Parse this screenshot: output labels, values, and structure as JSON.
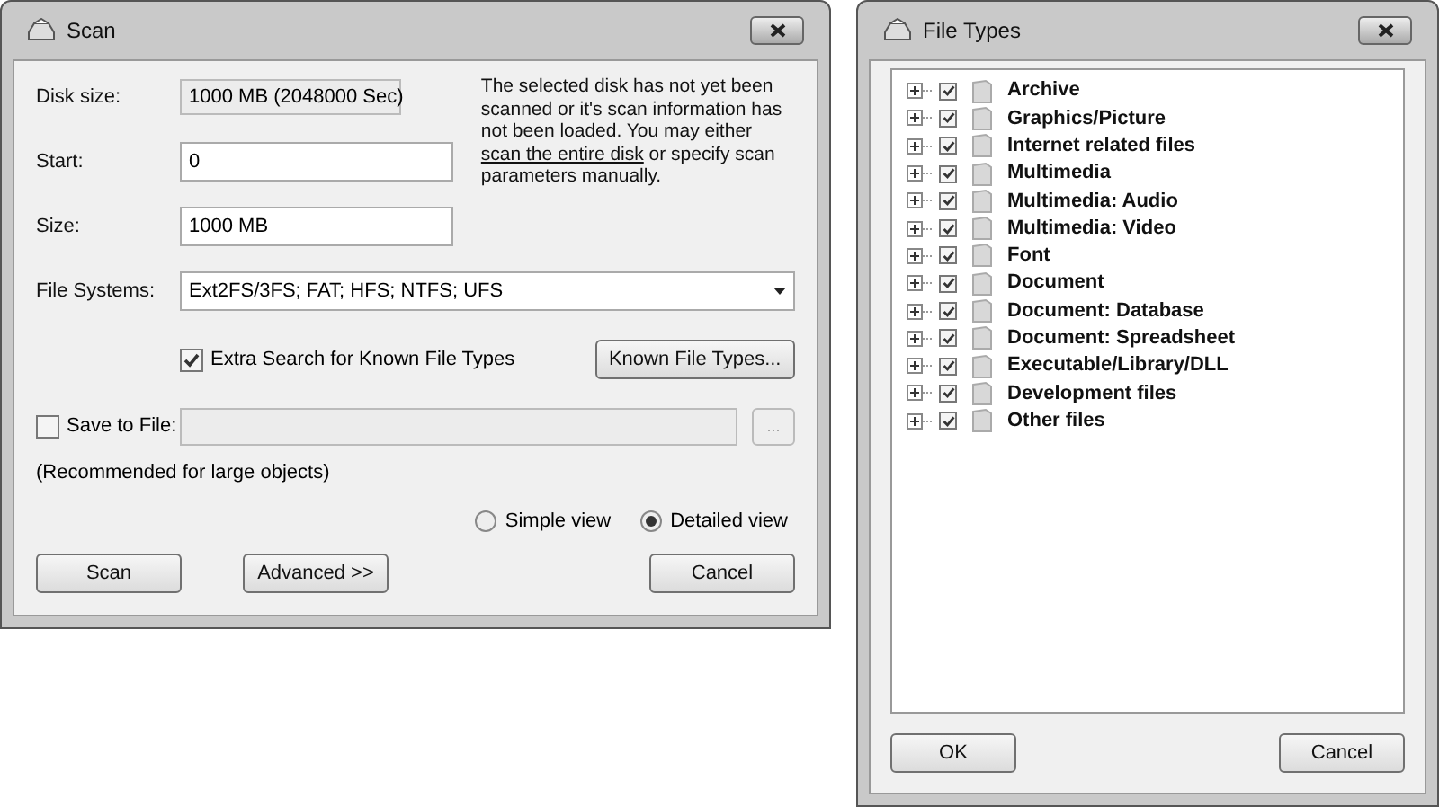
{
  "scan_window": {
    "title": "Scan",
    "disk_size": {
      "label": "Disk size:",
      "value": "1000 MB (2048000 Sec)"
    },
    "start": {
      "label": "Start:",
      "value": "0"
    },
    "size": {
      "label": "Size:",
      "value": "1000 MB"
    },
    "info": {
      "before": "The selected disk has not yet been scanned or it's scan information has not been loaded. You may either ",
      "link": "scan the entire disk",
      "after": " or specify scan parameters manually."
    },
    "file_systems": {
      "label": "File Systems:",
      "value": "Ext2FS/3FS; FAT; HFS; NTFS; UFS"
    },
    "extra_search": {
      "label": "Extra Search for Known File Types",
      "checked": true
    },
    "known_types_button": "Known File Types...",
    "save_to_file": {
      "label": "Save to File:",
      "checked": false,
      "browse": "..."
    },
    "note": "(Recommended for large objects)",
    "views": [
      {
        "label": "Simple view",
        "selected": false
      },
      {
        "label": "Detailed view",
        "selected": true
      }
    ],
    "buttons": [
      "Scan",
      "Advanced >>",
      "Cancel"
    ]
  },
  "file_types_window": {
    "title": "File Types",
    "items": [
      {
        "label": "Archive",
        "checked": true
      },
      {
        "label": "Graphics/Picture",
        "checked": true
      },
      {
        "label": "Internet related files",
        "checked": true
      },
      {
        "label": "Multimedia",
        "checked": true
      },
      {
        "label": "Multimedia: Audio",
        "checked": true
      },
      {
        "label": "Multimedia: Video",
        "checked": true
      },
      {
        "label": "Font",
        "checked": true
      },
      {
        "label": "Document",
        "checked": true
      },
      {
        "label": "Document: Database",
        "checked": true
      },
      {
        "label": "Document: Spreadsheet",
        "checked": true
      },
      {
        "label": "Executable/Library/DLL",
        "checked": true
      },
      {
        "label": "Development files",
        "checked": true
      },
      {
        "label": "Other files",
        "checked": true
      }
    ],
    "buttons": [
      "OK",
      "Cancel"
    ]
  }
}
